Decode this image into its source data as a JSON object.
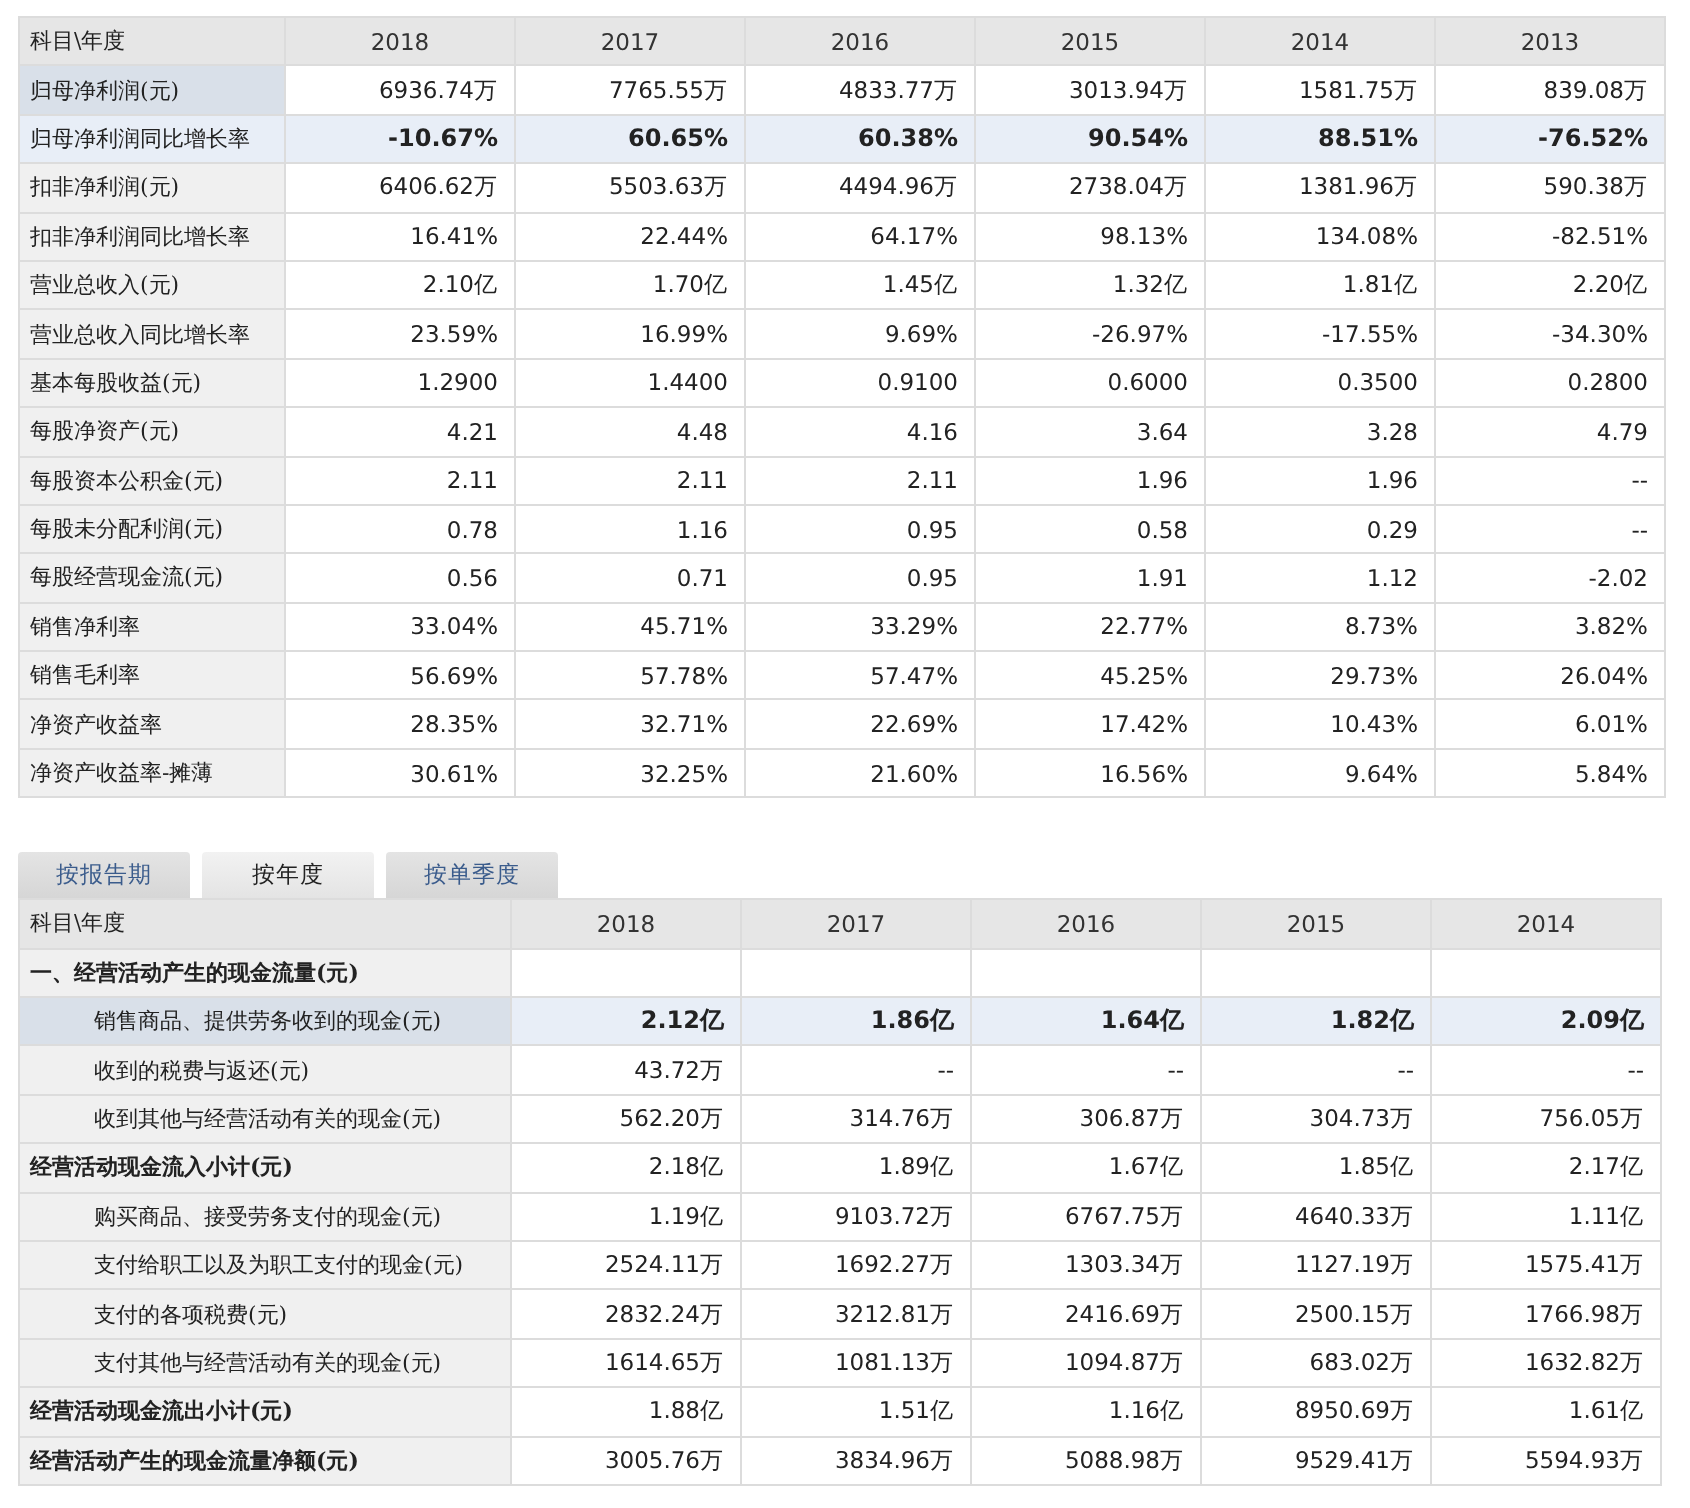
{
  "summary_table": {
    "corner": "科目\\年度",
    "years": [
      "2018",
      "2017",
      "2016",
      "2015",
      "2014",
      "2013"
    ],
    "rows": [
      {
        "label": "归母净利润(元)",
        "values": [
          "6936.74万",
          "7765.55万",
          "4833.77万",
          "3013.94万",
          "1581.75万",
          "839.08万"
        ],
        "highlighted": false,
        "label_selected": true
      },
      {
        "label": "归母净利润同比增长率",
        "values": [
          "-10.67%",
          "60.65%",
          "60.38%",
          "90.54%",
          "88.51%",
          "-76.52%"
        ],
        "highlighted": true,
        "label_selected": false
      },
      {
        "label": "扣非净利润(元)",
        "values": [
          "6406.62万",
          "5503.63万",
          "4494.96万",
          "2738.04万",
          "1381.96万",
          "590.38万"
        ],
        "highlighted": false,
        "label_selected": false
      },
      {
        "label": "扣非净利润同比增长率",
        "values": [
          "16.41%",
          "22.44%",
          "64.17%",
          "98.13%",
          "134.08%",
          "-82.51%"
        ],
        "highlighted": false,
        "label_selected": false
      },
      {
        "label": "营业总收入(元)",
        "values": [
          "2.10亿",
          "1.70亿",
          "1.45亿",
          "1.32亿",
          "1.81亿",
          "2.20亿"
        ],
        "highlighted": false,
        "label_selected": false
      },
      {
        "label": "营业总收入同比增长率",
        "values": [
          "23.59%",
          "16.99%",
          "9.69%",
          "-26.97%",
          "-17.55%",
          "-34.30%"
        ],
        "highlighted": false,
        "label_selected": false
      },
      {
        "label": "基本每股收益(元)",
        "values": [
          "1.2900",
          "1.4400",
          "0.9100",
          "0.6000",
          "0.3500",
          "0.2800"
        ],
        "highlighted": false,
        "label_selected": false
      },
      {
        "label": "每股净资产(元)",
        "values": [
          "4.21",
          "4.48",
          "4.16",
          "3.64",
          "3.28",
          "4.79"
        ],
        "highlighted": false,
        "label_selected": false
      },
      {
        "label": "每股资本公积金(元)",
        "values": [
          "2.11",
          "2.11",
          "2.11",
          "1.96",
          "1.96",
          "--"
        ],
        "highlighted": false,
        "label_selected": false
      },
      {
        "label": "每股未分配利润(元)",
        "values": [
          "0.78",
          "1.16",
          "0.95",
          "0.58",
          "0.29",
          "--"
        ],
        "highlighted": false,
        "label_selected": false
      },
      {
        "label": "每股经营现金流(元)",
        "values": [
          "0.56",
          "0.71",
          "0.95",
          "1.91",
          "1.12",
          "-2.02"
        ],
        "highlighted": false,
        "label_selected": false
      },
      {
        "label": "销售净利率",
        "values": [
          "33.04%",
          "45.71%",
          "33.29%",
          "22.77%",
          "8.73%",
          "3.82%"
        ],
        "highlighted": false,
        "label_selected": false
      },
      {
        "label": "销售毛利率",
        "values": [
          "56.69%",
          "57.78%",
          "57.47%",
          "45.25%",
          "29.73%",
          "26.04%"
        ],
        "highlighted": false,
        "label_selected": false
      },
      {
        "label": "净资产收益率",
        "values": [
          "28.35%",
          "32.71%",
          "22.69%",
          "17.42%",
          "10.43%",
          "6.01%"
        ],
        "highlighted": false,
        "label_selected": false
      },
      {
        "label": "净资产收益率-摊薄",
        "values": [
          "30.61%",
          "32.25%",
          "21.60%",
          "16.56%",
          "9.64%",
          "5.84%"
        ],
        "highlighted": false,
        "label_selected": false
      }
    ]
  },
  "tabs": [
    {
      "label": "按报告期",
      "selected": false
    },
    {
      "label": "按年度",
      "selected": true
    },
    {
      "label": "按单季度",
      "selected": false
    }
  ],
  "cashflow_table": {
    "corner": "科目\\年度",
    "years": [
      "2018",
      "2017",
      "2016",
      "2015",
      "2014"
    ],
    "rows": [
      {
        "kind": "section",
        "label": "一、经营活动产生的现金流量(元)",
        "values": [],
        "highlighted": false,
        "label_selected": false
      },
      {
        "kind": "item",
        "label": "销售商品、提供劳务收到的现金(元)",
        "values": [
          "2.12亿",
          "1.86亿",
          "1.64亿",
          "1.82亿",
          "2.09亿"
        ],
        "highlighted": true,
        "label_selected": true
      },
      {
        "kind": "item",
        "label": "收到的税费与返还(元)",
        "values": [
          "43.72万",
          "--",
          "--",
          "--",
          "--"
        ],
        "highlighted": false,
        "label_selected": false
      },
      {
        "kind": "item",
        "label": "收到其他与经营活动有关的现金(元)",
        "values": [
          "562.20万",
          "314.76万",
          "306.87万",
          "304.73万",
          "756.05万"
        ],
        "highlighted": false,
        "label_selected": false
      },
      {
        "kind": "subtotal",
        "label": "经营活动现金流入小计(元)",
        "values": [
          "2.18亿",
          "1.89亿",
          "1.67亿",
          "1.85亿",
          "2.17亿"
        ],
        "highlighted": false,
        "label_selected": false
      },
      {
        "kind": "item",
        "label": "购买商品、接受劳务支付的现金(元)",
        "values": [
          "1.19亿",
          "9103.72万",
          "6767.75万",
          "4640.33万",
          "1.11亿"
        ],
        "highlighted": false,
        "label_selected": false
      },
      {
        "kind": "item",
        "label": "支付给职工以及为职工支付的现金(元)",
        "values": [
          "2524.11万",
          "1692.27万",
          "1303.34万",
          "1127.19万",
          "1575.41万"
        ],
        "highlighted": false,
        "label_selected": false
      },
      {
        "kind": "item",
        "label": "支付的各项税费(元)",
        "values": [
          "2832.24万",
          "3212.81万",
          "2416.69万",
          "2500.15万",
          "1766.98万"
        ],
        "highlighted": false,
        "label_selected": false
      },
      {
        "kind": "item",
        "label": "支付其他与经营活动有关的现金(元)",
        "values": [
          "1614.65万",
          "1081.13万",
          "1094.87万",
          "683.02万",
          "1632.82万"
        ],
        "highlighted": false,
        "label_selected": false
      },
      {
        "kind": "subtotal",
        "label": "经营活动现金流出小计(元)",
        "values": [
          "1.88亿",
          "1.51亿",
          "1.16亿",
          "8950.69万",
          "1.61亿"
        ],
        "highlighted": false,
        "label_selected": false
      },
      {
        "kind": "subtotal",
        "label": "经营活动产生的现金流量净额(元)",
        "values": [
          "3005.76万",
          "3834.96万",
          "5088.98万",
          "9529.41万",
          "5594.93万"
        ],
        "highlighted": false,
        "label_selected": false
      }
    ]
  }
}
